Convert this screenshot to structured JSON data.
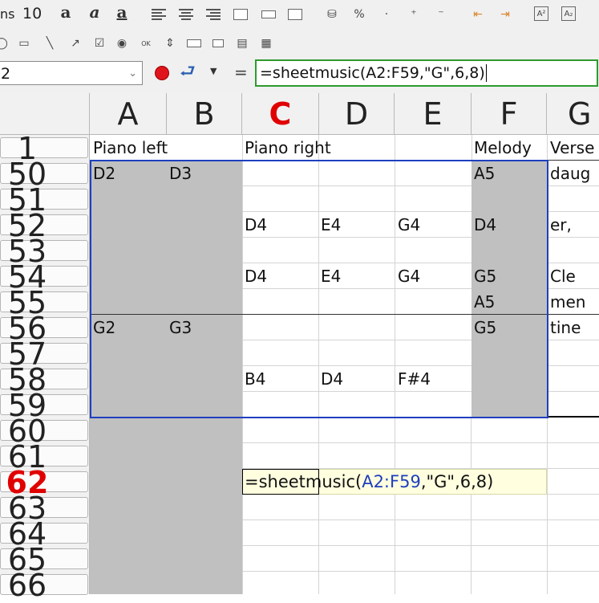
{
  "toolbar": {
    "font_name_fragment": "ns",
    "font_size": "10",
    "style_icons": [
      "bold-a-icon",
      "italic-a-icon",
      "underline-a-icon"
    ]
  },
  "formula_bar": {
    "name_box": "2",
    "equals_label": "=",
    "formula": "=sheetmusic(A2:F59,\"G\",6,8)"
  },
  "columns": [
    "A",
    "B",
    "C",
    "D",
    "E",
    "F",
    "G"
  ],
  "selected_column": "C",
  "rows": [
    "1",
    "50",
    "51",
    "52",
    "53",
    "54",
    "55",
    "56",
    "57",
    "58",
    "59",
    "60",
    "61",
    "62",
    "63",
    "64",
    "65",
    "66"
  ],
  "selected_row": "62",
  "cells": {
    "r1": {
      "A": "Piano left",
      "C": "Piano right",
      "F": "Melody",
      "G": "Verse"
    },
    "r50": {
      "A": "D2",
      "B": "D3",
      "F": "A5",
      "G": "daug"
    },
    "r52": {
      "C": "D4",
      "D": "E4",
      "E": "G4",
      "F": "D4",
      "G": "er,"
    },
    "r54": {
      "C": "D4",
      "D": "E4",
      "E": "G4",
      "F": "G5",
      "G": "Cle"
    },
    "r55": {
      "F": "A5",
      "G": "men"
    },
    "r56": {
      "A": "G2",
      "B": "G3",
      "F": "G5",
      "G": "tine"
    },
    "r58": {
      "C": "B4",
      "D": "D4",
      "E": "F#4"
    }
  },
  "tooltip": {
    "prefix": "=sheetmusic(",
    "range": "A2:F59",
    "suffix": ",\"G\",6,8)"
  },
  "colors": {
    "accent_selection": "#1f3fbf",
    "selected_header": "#e00000",
    "formula_border": "#2e9a2e",
    "shaded_column": "#c0c0c0"
  }
}
